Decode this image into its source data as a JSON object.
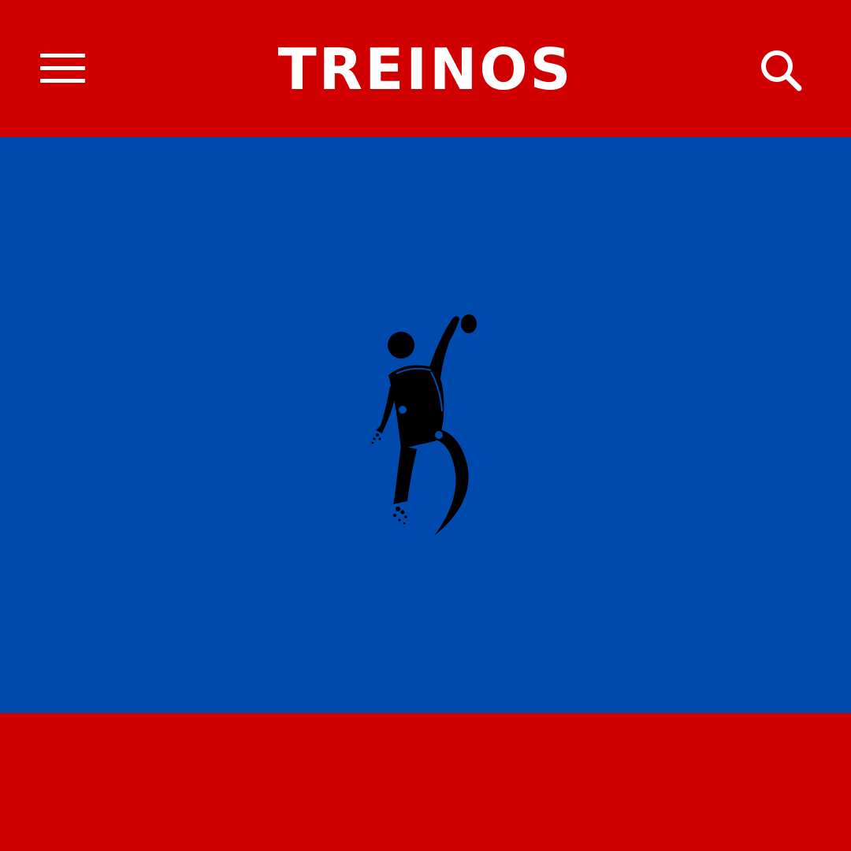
{
  "header": {
    "title": "TREINOS",
    "menu_icon": "hamburger-menu-icon",
    "search_icon": "search-icon"
  },
  "hero": {
    "logo_icon": "handball-player-icon"
  },
  "colors": {
    "primary_red": "#d10000",
    "primary_blue": "#004aad",
    "text_white": "#ffffff",
    "logo_black": "#000000"
  }
}
